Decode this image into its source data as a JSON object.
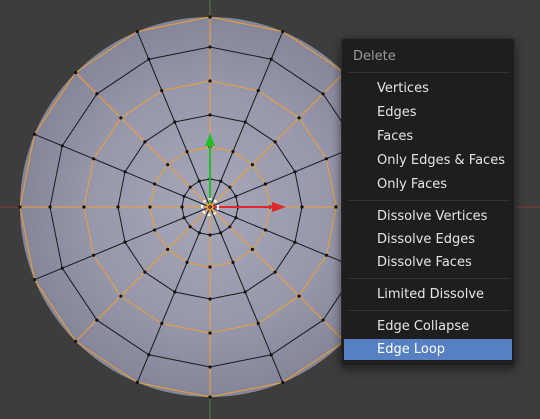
{
  "menu": {
    "title": "Delete",
    "items": [
      {
        "label": "Vertices"
      },
      {
        "label": "Edges"
      },
      {
        "label": "Faces"
      },
      {
        "label": "Only Edges & Faces"
      },
      {
        "label": "Only Faces"
      },
      {
        "label": "Dissolve Vertices"
      },
      {
        "label": "Dissolve Edges"
      },
      {
        "label": "Dissolve Faces"
      },
      {
        "label": "Limited Dissolve"
      },
      {
        "label": "Edge Collapse"
      },
      {
        "label": "Edge Loop",
        "highlighted": true
      }
    ]
  },
  "colors": {
    "viewport_background": "#3d3d3d",
    "mesh_face": "#8f8fa3",
    "selected_edge": "#f0a030",
    "x_axis": "#e02828",
    "y_axis": "#22c022",
    "menu_background": "#1e1e1e",
    "menu_highlight": "#5680c2"
  },
  "icons": [
    "manipulator-x-arrow-icon",
    "manipulator-y-arrow-icon",
    "3d-cursor-icon"
  ]
}
